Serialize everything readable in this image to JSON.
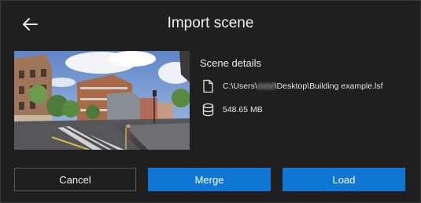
{
  "dialog": {
    "title": "Import scene",
    "back_icon": "arrow-left-icon"
  },
  "details": {
    "heading": "Scene details",
    "path_prefix": "C:\\Users\\",
    "path_suffix": "\\Desktop\\Building example.lsf",
    "path_icon": "file-icon",
    "size": "548.65 MB",
    "size_icon": "database-icon"
  },
  "buttons": {
    "cancel": "Cancel",
    "merge": "Merge",
    "load": "Load"
  },
  "colors": {
    "background": "#1f1f1f",
    "accent": "#0f76d3",
    "border": "#5a5a5a"
  }
}
